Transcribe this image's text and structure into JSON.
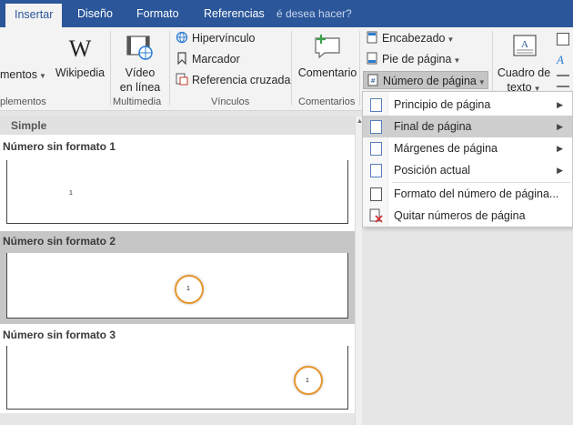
{
  "tabs": [
    {
      "label": "Insertar",
      "active": true
    },
    {
      "label": "Diseño"
    },
    {
      "label": "Formato"
    },
    {
      "label": "Referencias"
    },
    {
      "label": "é desea hacer?"
    }
  ],
  "ribbon": {
    "complementos_label": "mentos",
    "complementos_group": "plementos",
    "wikipedia": "Wikipedia",
    "video_line1": "Vídeo",
    "video_line2": "en línea",
    "multimedia_group": "Multimedia",
    "vinculos": [
      "Hipervínculo",
      "Marcador",
      "Referencia cruzada"
    ],
    "vinculos_group": "Vínculos",
    "comentario": "Comentario",
    "comentarios_group": "Comentarios",
    "header_items": [
      "Encabezado",
      "Pie de página",
      "Número de página"
    ],
    "textbox_line1": "Cuadro de",
    "textbox_line2": "texto"
  },
  "gallery": {
    "header": "Simple",
    "items": [
      {
        "title": "Número sin formato 1",
        "number": "1"
      },
      {
        "title": "Número sin formato 2",
        "number": "1"
      },
      {
        "title": "Número sin formato 3",
        "number": "1"
      }
    ]
  },
  "menu": {
    "items": [
      {
        "label": "Principio de página",
        "submenu": true
      },
      {
        "label": "Final de página",
        "submenu": true,
        "highlighted": true
      },
      {
        "label": "Márgenes de página",
        "submenu": true
      },
      {
        "label": "Posición actual",
        "submenu": true
      },
      {
        "label": "Formato del número de página..."
      },
      {
        "label": "Quitar números de página"
      }
    ]
  },
  "colors": {
    "accent": "#2b579a",
    "highlight_ring": "#e6962e"
  }
}
